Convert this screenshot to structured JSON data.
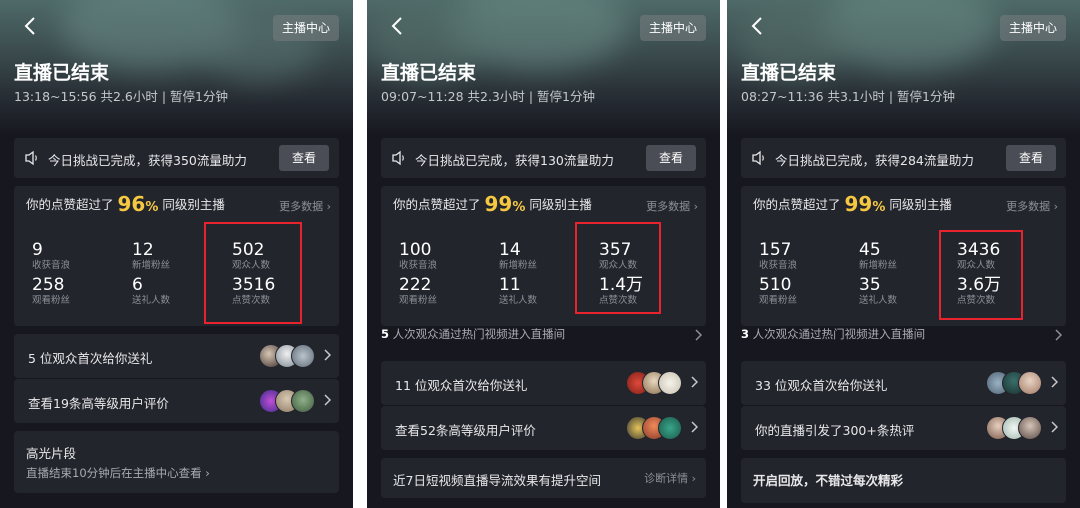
{
  "panels": [
    {
      "back_icon": "chevron-left-icon",
      "host_center": "主播中心",
      "title": "直播已结束",
      "subtitle": "13:18~15:56 共2.6小时 | 暂停1分钟",
      "notice": {
        "text": "今日挑战已完成，获得350流量助力",
        "button": "查看"
      },
      "likes": {
        "prefix": "你的点赞超过了",
        "pct": "96",
        "pct_unit": "%",
        "suffix": "同级别主播",
        "more": "更多数据"
      },
      "stats": [
        {
          "value": "9",
          "label": "收获音浪"
        },
        {
          "value": "12",
          "label": "新增粉丝"
        },
        {
          "value": "502",
          "label": "观众人数"
        },
        {
          "value": "258",
          "label": "观看粉丝"
        },
        {
          "value": "6",
          "label": "送礼人数"
        },
        {
          "value": "3516",
          "label": "点赞次数"
        }
      ],
      "rows": [
        {
          "text": "5 位观众首次给你送礼"
        },
        {
          "text": "查看19条高等级用户评价"
        }
      ],
      "highlight": {
        "title": "高光片段",
        "sub": "直播结束10分钟后在主播中心查看"
      }
    },
    {
      "back_icon": "chevron-left-icon",
      "host_center": "主播中心",
      "title": "直播已结束",
      "subtitle": "09:07~11:28 共2.3小时 | 暂停1分钟",
      "notice": {
        "text": "今日挑战已完成，获得130流量助力",
        "button": "查看"
      },
      "likes": {
        "prefix": "你的点赞超过了",
        "pct": "99",
        "pct_unit": "%",
        "suffix": "同级别主播",
        "more": "更多数据"
      },
      "stats": [
        {
          "value": "100",
          "label": "收获音浪"
        },
        {
          "value": "14",
          "label": "新增粉丝"
        },
        {
          "value": "357",
          "label": "观众人数"
        },
        {
          "value": "222",
          "label": "观看粉丝"
        },
        {
          "value": "11",
          "label": "送礼人数"
        },
        {
          "value": "1.4万",
          "label": "点赞次数"
        }
      ],
      "hint": {
        "num": "5",
        "text": " 人次观众通过热门视频进入直播间"
      },
      "rows": [
        {
          "text": "11 位观众首次给你送礼"
        },
        {
          "text": "查看52条高等级用户评价"
        }
      ],
      "diagnose": {
        "text": "近7日短视频直播导流效果有提升空间",
        "link": "诊断详情"
      }
    },
    {
      "back_icon": "chevron-left-icon",
      "host_center": "主播中心",
      "title": "直播已结束",
      "subtitle": "08:27~11:36 共3.1小时 | 暂停1分钟",
      "notice": {
        "text": "今日挑战已完成，获得284流量助力",
        "button": "查看"
      },
      "likes": {
        "prefix": "你的点赞超过了",
        "pct": "99",
        "pct_unit": "%",
        "suffix": "同级别主播",
        "more": "更多数据"
      },
      "stats": [
        {
          "value": "157",
          "label": "收获音浪"
        },
        {
          "value": "45",
          "label": "新增粉丝"
        },
        {
          "value": "3436",
          "label": "观众人数"
        },
        {
          "value": "510",
          "label": "观看粉丝"
        },
        {
          "value": "35",
          "label": "送礼人数"
        },
        {
          "value": "3.6万",
          "label": "点赞次数"
        }
      ],
      "hint": {
        "num": "3",
        "text": " 人次观众通过热门视频进入直播间"
      },
      "rows": [
        {
          "text": "33 位观众首次给你送礼"
        },
        {
          "text": "你的直播引发了300+条热评"
        }
      ],
      "replay": {
        "title": "开启回放，不错过每次精彩"
      }
    }
  ],
  "colors": {
    "accent_gold": "#f6c842",
    "highlight_red": "#e8232d",
    "card_bg": "#23252d",
    "page_bg": "#17181f"
  }
}
